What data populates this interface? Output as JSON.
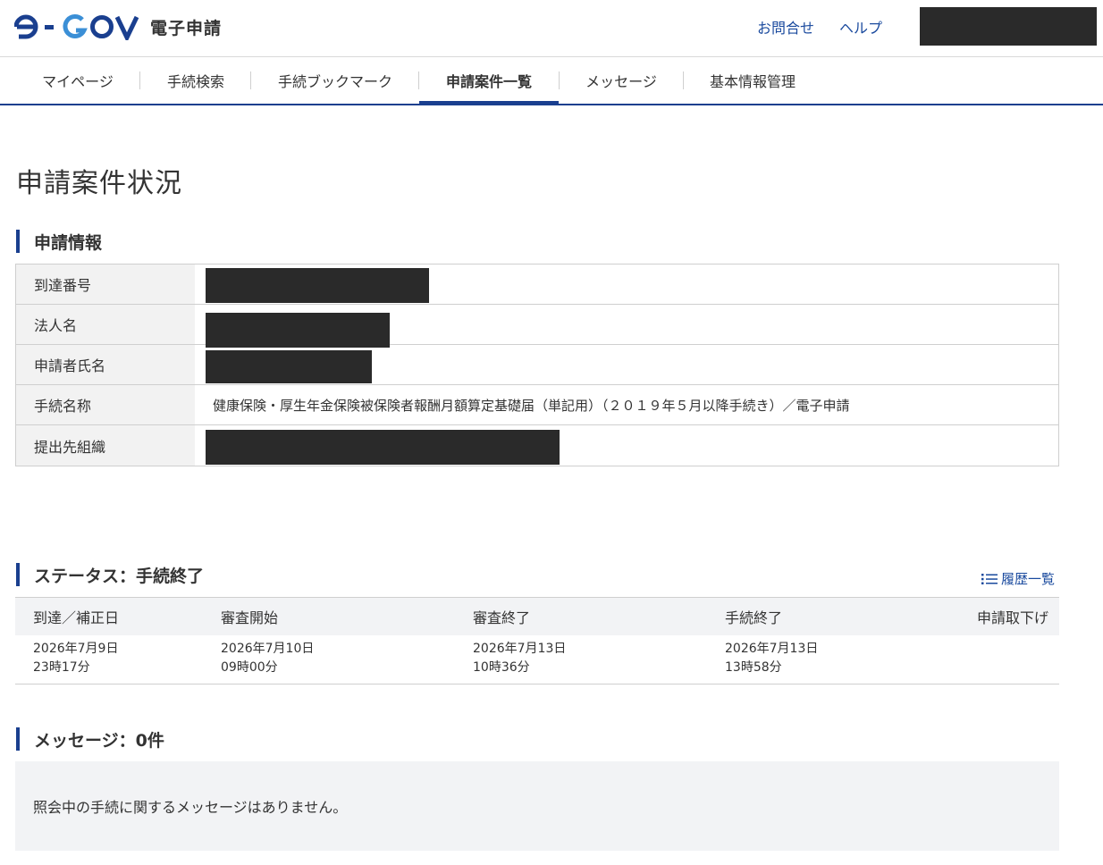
{
  "header": {
    "logo_text": "電子申請",
    "contact_label": "お問合せ",
    "help_label": "ヘルプ"
  },
  "nav": {
    "items": [
      {
        "label": "マイページ"
      },
      {
        "label": "手続検索"
      },
      {
        "label": "手続ブックマーク"
      },
      {
        "label": "申請案件一覧"
      },
      {
        "label": "メッセージ"
      },
      {
        "label": "基本情報管理"
      }
    ]
  },
  "page": {
    "title": "申請案件状況"
  },
  "application_info": {
    "heading": "申請情報",
    "rows": [
      {
        "label": "到達番号",
        "value": ""
      },
      {
        "label": "法人名",
        "value": ""
      },
      {
        "label": "申請者氏名",
        "value": ""
      },
      {
        "label": "手続名称",
        "value": "健康保険・厚生年金保険被保険者報酬月額算定基礎届（単記用）（２０１９年５月以降手続き）／電子申請"
      },
      {
        "label": "提出先組織",
        "value": ""
      }
    ]
  },
  "status": {
    "heading": "ステータス：手続終了",
    "history_label": "履歴一覧",
    "columns": [
      "到達／補正日",
      "審査開始",
      "審査終了",
      "手続終了",
      "申請取下げ"
    ],
    "dates": [
      {
        "date": "2026年7月9日",
        "time": "23時17分"
      },
      {
        "date": "2026年7月10日",
        "time": "09時00分"
      },
      {
        "date": "2026年7月13日",
        "time": "10時36分"
      },
      {
        "date": "2026年7月13日",
        "time": "13時58分"
      },
      {
        "date": "",
        "time": ""
      }
    ]
  },
  "messages": {
    "heading": "メッセージ：0件",
    "empty_text": "照会中の手続に関するメッセージはありません。"
  },
  "colors": {
    "brand_blue": "#1a3f8f",
    "link_blue": "#1a4a9e",
    "redaction": "#2a2a2a"
  }
}
